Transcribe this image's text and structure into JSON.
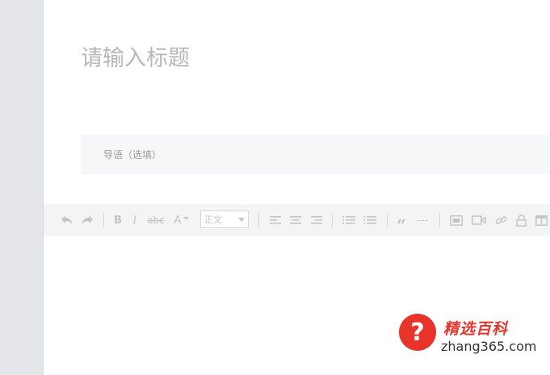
{
  "title": {
    "placeholder": "请输入标题"
  },
  "summary": {
    "placeholder": "导语（选填）"
  },
  "toolbar": {
    "undo_icon": "undo-icon",
    "redo_icon": "redo-icon",
    "bold_label": "B",
    "italic_label": "I",
    "strike_label": "abc",
    "font_size_label": "A",
    "format_select": {
      "value": "正文"
    },
    "quote_label": "“",
    "divider_label": "---"
  },
  "watermark": {
    "symbol": "?",
    "brand": "精选百科",
    "domain": "zhang365.com"
  },
  "colors": {
    "sidebar": "#e4e5e8",
    "toolbar": "#f3f4f5",
    "summary_bg": "#f6f7f8",
    "placeholder": "#b7b7b7",
    "icon": "#c4c4c4",
    "brand_red": "#e8342a"
  }
}
